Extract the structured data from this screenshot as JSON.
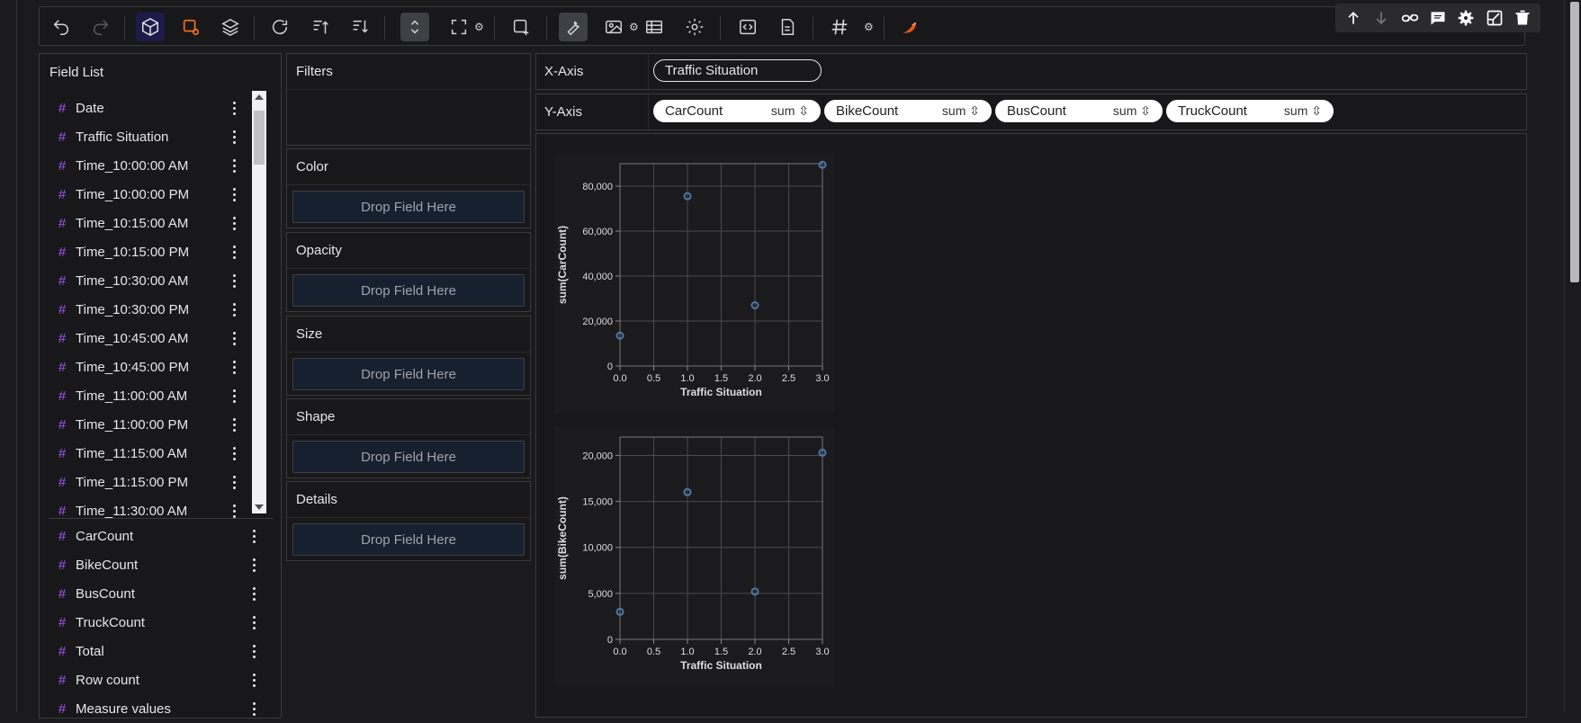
{
  "field_list": {
    "title": "Field List",
    "dimensions": [
      "Date",
      "Traffic Situation",
      "Time_10:00:00 AM",
      "Time_10:00:00 PM",
      "Time_10:15:00 AM",
      "Time_10:15:00 PM",
      "Time_10:30:00 AM",
      "Time_10:30:00 PM",
      "Time_10:45:00 AM",
      "Time_10:45:00 PM",
      "Time_11:00:00 AM",
      "Time_11:00:00 PM",
      "Time_11:15:00 AM",
      "Time_11:15:00 PM",
      "Time_11:30:00 AM"
    ],
    "measures": [
      "CarCount",
      "BikeCount",
      "BusCount",
      "TruckCount",
      "Total",
      "Row count",
      "Measure values"
    ],
    "field_icon": "#"
  },
  "encodings": {
    "filters": "Filters",
    "color": "Color",
    "opacity": "Opacity",
    "size": "Size",
    "shape": "Shape",
    "details": "Details",
    "drop_placeholder": "Drop Field Here"
  },
  "axes": {
    "x_label": "X-Axis",
    "y_label": "Y-Axis",
    "x_field": "Traffic Situation",
    "y_fields": [
      {
        "name": "CarCount",
        "agg": "sum"
      },
      {
        "name": "BikeCount",
        "agg": "sum"
      },
      {
        "name": "BusCount",
        "agg": "sum"
      },
      {
        "name": "TruckCount",
        "agg": "sum"
      }
    ]
  },
  "colors": {
    "point": "#4c78a8",
    "accent_purple": "#a855f7",
    "accent_orange": "#f97316"
  },
  "chart_data": [
    {
      "type": "scatter",
      "xlabel": "Traffic Situation",
      "ylabel": "sum(CarCount)",
      "x": [
        0,
        1,
        2,
        3
      ],
      "y": [
        13500,
        75500,
        27000,
        89500
      ],
      "xlim": [
        0,
        3
      ],
      "ylim": [
        0,
        90000
      ],
      "xticks": [
        "0.0",
        "0.5",
        "1.0",
        "1.5",
        "2.0",
        "2.5",
        "3.0"
      ],
      "yticks": [
        "0",
        "20,000",
        "40,000",
        "60,000",
        "80,000"
      ],
      "grid": true
    },
    {
      "type": "scatter",
      "xlabel": "Traffic Situation",
      "ylabel": "sum(BikeCount)",
      "x": [
        0,
        1,
        2,
        3
      ],
      "y": [
        3000,
        16000,
        5200,
        20300
      ],
      "xlim": [
        0,
        3
      ],
      "ylim": [
        0,
        22000
      ],
      "xticks": [
        "0.0",
        "0.5",
        "1.0",
        "1.5",
        "2.0",
        "2.5",
        "3.0"
      ],
      "yticks": [
        "0",
        "5,000",
        "10,000",
        "15,000",
        "20,000"
      ],
      "grid": true
    }
  ]
}
